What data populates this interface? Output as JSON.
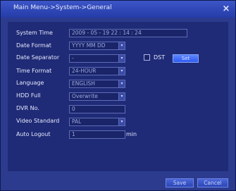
{
  "window": {
    "title": "Main Menu->System->General"
  },
  "settings": {
    "system_time": {
      "label": "System Time",
      "value": "2009 - 05 - 19   22 : 14 : 24"
    },
    "date_format": {
      "label": "Date Format",
      "value": "YYYY MM DD"
    },
    "date_separator": {
      "label": "Date Separator",
      "value": "-"
    },
    "time_format": {
      "label": "Time Format",
      "value": "24-HOUR"
    },
    "language": {
      "label": "Language",
      "value": "ENGLISH"
    },
    "hdd_full": {
      "label": "HDD Full",
      "value": "Overwrite"
    },
    "dvr_no": {
      "label": "DVR No.",
      "value": "0"
    },
    "video_standard": {
      "label": "Video Standard",
      "value": "PAL"
    },
    "auto_logout": {
      "label": "Auto Logout",
      "value": "1",
      "unit": "min"
    },
    "dst": {
      "label": "DST",
      "checked": false
    },
    "set_button": "Set"
  },
  "footer": {
    "save_label": "Save",
    "cancel_label": "Cancel"
  },
  "icons": {
    "close": "close-icon",
    "dropdown": "dropdown-arrow-icon"
  },
  "colors": {
    "window_bg": "#2c3b8e",
    "panel_bg": "#1f2b76",
    "accent_button": "#2f5bf0"
  }
}
